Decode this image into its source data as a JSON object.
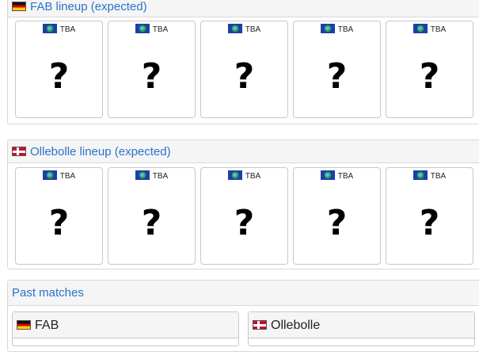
{
  "lineups": [
    {
      "title": "FAB lineup (expected)",
      "flag_icon": "germany-flag-icon",
      "players": [
        {
          "region_icon": "globe-flag-icon",
          "region_label": "TBA",
          "placeholder": "?"
        },
        {
          "region_icon": "globe-flag-icon",
          "region_label": "TBA",
          "placeholder": "?"
        },
        {
          "region_icon": "globe-flag-icon",
          "region_label": "TBA",
          "placeholder": "?"
        },
        {
          "region_icon": "globe-flag-icon",
          "region_label": "TBA",
          "placeholder": "?"
        },
        {
          "region_icon": "globe-flag-icon",
          "region_label": "TBA",
          "placeholder": "?"
        }
      ]
    },
    {
      "title": "Ollebolle lineup (expected)",
      "flag_icon": "denmark-flag-icon",
      "players": [
        {
          "region_icon": "globe-flag-icon",
          "region_label": "TBA",
          "placeholder": "?"
        },
        {
          "region_icon": "globe-flag-icon",
          "region_label": "TBA",
          "placeholder": "?"
        },
        {
          "region_icon": "globe-flag-icon",
          "region_label": "TBA",
          "placeholder": "?"
        },
        {
          "region_icon": "globe-flag-icon",
          "region_label": "TBA",
          "placeholder": "?"
        },
        {
          "region_icon": "globe-flag-icon",
          "region_label": "TBA",
          "placeholder": "?"
        }
      ]
    }
  ],
  "past_matches": {
    "title": "Past matches",
    "teams": [
      {
        "name": "FAB",
        "flag_icon": "germany-flag-icon"
      },
      {
        "name": "Ollebolle",
        "flag_icon": "denmark-flag-icon"
      }
    ]
  },
  "colors": {
    "header_link": "#2a72c9",
    "header_bg": "#f5f5f5",
    "border": "#d8d8d8"
  }
}
